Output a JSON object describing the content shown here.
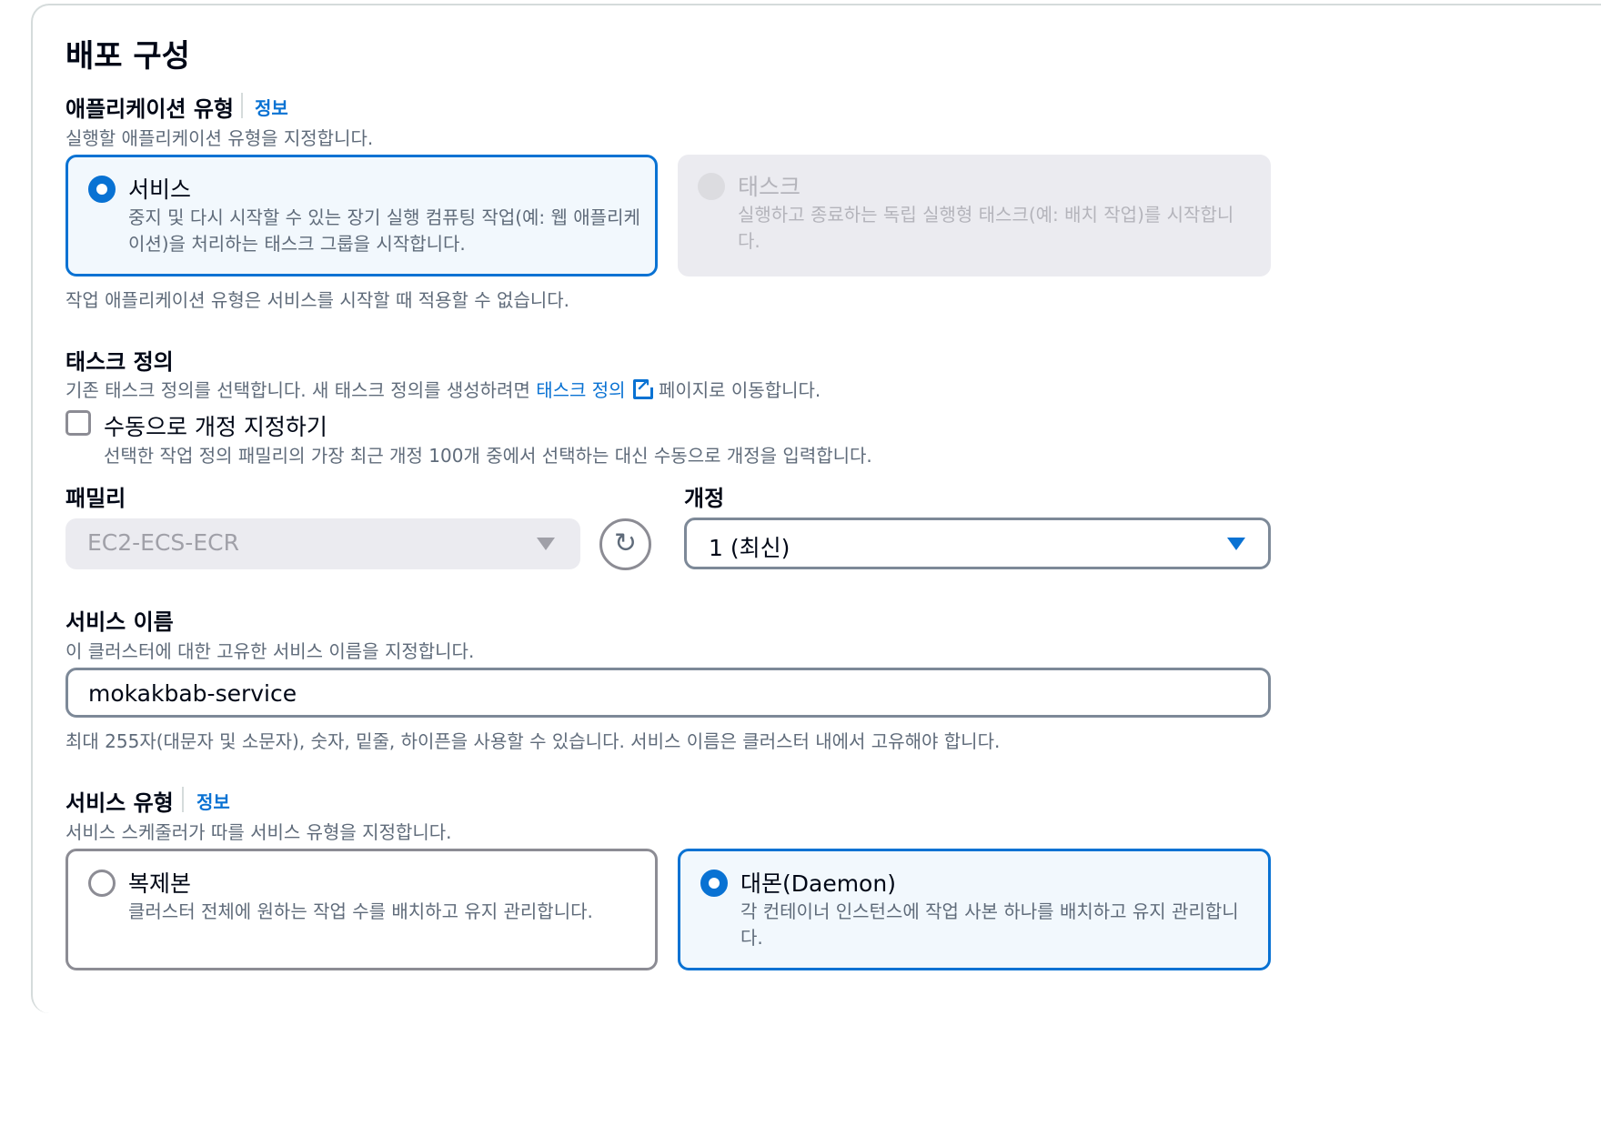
{
  "title": "배포 구성",
  "app_type": {
    "label": "애플리케이션 유형",
    "info": "정보",
    "desc": "실행할 애플리케이션 유형을 지정합니다.",
    "service": {
      "title": "서비스",
      "desc": "중지 및 다시 시작할 수 있는 장기 실행 컴퓨팅 작업(예: 웹 애플리케이션)을 처리하는 태스크 그룹을 시작합니다."
    },
    "task": {
      "title": "태스크",
      "desc": "실행하고 종료하는 독립 실행형 태스크(예: 배치 작업)를 시작합니다."
    },
    "note": "작업 애플리케이션 유형은 서비스를 시작할 때 적용할 수 없습니다."
  },
  "task_def": {
    "label": "태스크 정의",
    "desc_pre": "기존 태스크 정의를 선택합니다. 새 태스크 정의를 생성하려면",
    "link": "태스크 정의",
    "desc_post": "페이지로 이동합니다.",
    "manual_label": "수동으로 개정 지정하기",
    "manual_desc": "선택한 작업 정의 패밀리의 가장 최근 개정 100개 중에서 선택하는 대신 수동으로 개정을 입력합니다.",
    "family_label": "패밀리",
    "family_value": "EC2-ECS-ECR",
    "revision_label": "개정",
    "revision_value": "1 (최신)"
  },
  "service_name": {
    "label": "서비스 이름",
    "desc": "이 클러스터에 대한 고유한 서비스 이름을 지정합니다.",
    "value": "mokakbab-service",
    "hint": "최대 255자(대문자 및 소문자), 숫자, 밑줄, 하이픈을 사용할 수 있습니다. 서비스 이름은 클러스터 내에서 고유해야 합니다."
  },
  "service_type": {
    "label": "서비스 유형",
    "info": "정보",
    "desc": "서비스 스케줄러가 따를 서비스 유형을 지정합니다.",
    "replica": {
      "title": "복제본",
      "desc": "클러스터 전체에 원하는 작업 수를 배치하고 유지 관리합니다."
    },
    "daemon": {
      "title": "대몬(Daemon)",
      "desc": "각 컨테이너 인스턴스에 작업 사본 하나를 배치하고 유지 관리합니다."
    }
  }
}
